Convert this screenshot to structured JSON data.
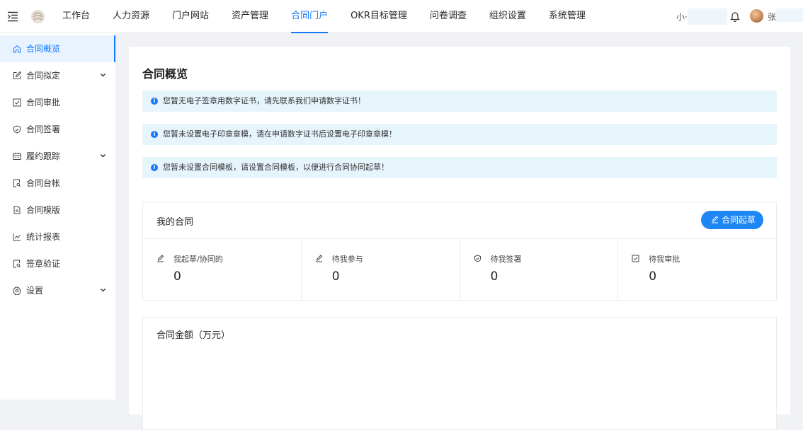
{
  "topnav": {
    "items": [
      "工作台",
      "人力资源",
      "门户网站",
      "资产管理",
      "合同门户",
      "OKR目标管理",
      "问卷调查",
      "组织设置",
      "系统管理"
    ],
    "active_index": 4,
    "accent_color": "#1677ff"
  },
  "user": {
    "org_name": "小·",
    "user_name": "张.",
    "bell_icon": "bell-icon",
    "avatar": "avatar"
  },
  "sidebar": {
    "items": [
      {
        "label": "合同概览",
        "icon": "home-icon",
        "active": true,
        "has_submenu": false
      },
      {
        "label": "合同拟定",
        "icon": "edit-icon",
        "active": false,
        "has_submenu": true
      },
      {
        "label": "合同审批",
        "icon": "checkbox-icon",
        "active": false,
        "has_submenu": false
      },
      {
        "label": "合同签署",
        "icon": "shield-icon",
        "active": false,
        "has_submenu": false
      },
      {
        "label": "履约跟踪",
        "icon": "calendar-icon",
        "active": false,
        "has_submenu": true
      },
      {
        "label": "合同台帐",
        "icon": "search-doc-icon",
        "active": false,
        "has_submenu": false
      },
      {
        "label": "合同模版",
        "icon": "document-icon",
        "active": false,
        "has_submenu": false
      },
      {
        "label": "统计报表",
        "icon": "line-chart-icon",
        "active": false,
        "has_submenu": false
      },
      {
        "label": "签章验证",
        "icon": "search-doc-icon",
        "active": false,
        "has_submenu": false
      },
      {
        "label": "设置",
        "icon": "gear-icon",
        "active": false,
        "has_submenu": true
      }
    ]
  },
  "main": {
    "title": "合同概览",
    "alerts": [
      "您暂无电子签章用数字证书，请先联系我们申请数字证书！",
      "您暂未设置电子印章章模，请在申请数字证书后设置电子印章章模！",
      "您暂未设置合同模板，请设置合同模板，以便进行合同协同起草！"
    ],
    "my_contracts": {
      "title": "我的合同",
      "draft_button": "合同起草",
      "stats": [
        {
          "label": "我起草/协同的",
          "value": "0",
          "icon": "edit-icon"
        },
        {
          "label": "待我参与",
          "value": "0",
          "icon": "edit-icon"
        },
        {
          "label": "待我签署",
          "value": "0",
          "icon": "shield-icon"
        },
        {
          "label": "待我审批",
          "value": "0",
          "icon": "checkbox-icon"
        }
      ]
    },
    "amount_card": {
      "title": "合同金额（万元）"
    }
  }
}
